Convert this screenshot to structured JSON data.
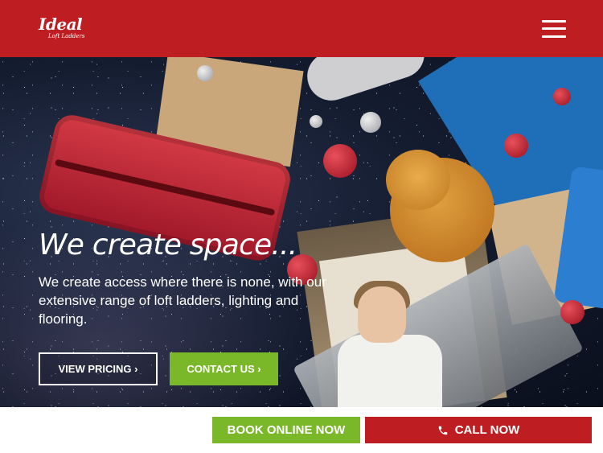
{
  "header": {
    "logo_main": "Ideal",
    "logo_sub": "Loft Ladders",
    "menu_icon": "hamburger-menu-icon"
  },
  "hero": {
    "title": "We create space...",
    "description": "We create access where there is none, with our extensive range of loft ladders, lighting and flooring.",
    "buttons": {
      "pricing_label": "VIEW PRICING",
      "contact_label": "CONTACT US",
      "chevron": "›"
    }
  },
  "bottom_bar": {
    "book_label": "BOOK ONLINE NOW",
    "call_label": "CALL NOW",
    "call_icon": "phone-icon"
  },
  "colors": {
    "brand_red": "#be1e22",
    "accent_green": "#7ab82a",
    "white": "#ffffff"
  }
}
